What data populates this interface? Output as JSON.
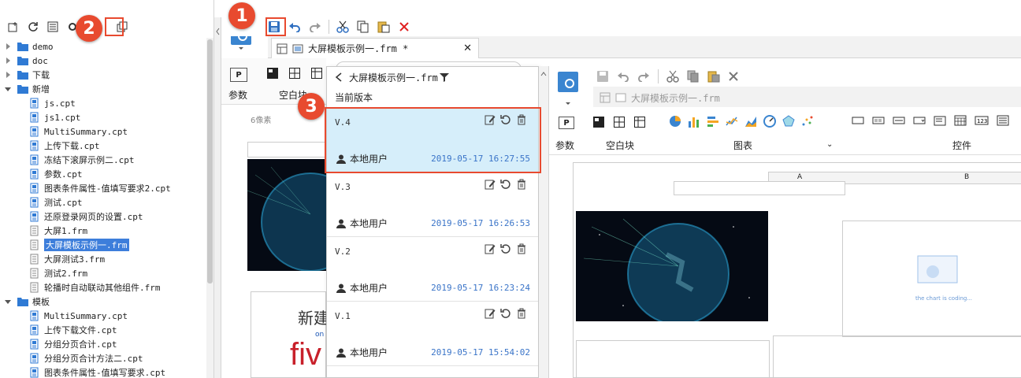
{
  "left_panel": {
    "tree": [
      {
        "label": "demo",
        "type": "folder",
        "level": 0,
        "expanded": false
      },
      {
        "label": "doc",
        "type": "folder",
        "level": 0,
        "expanded": false
      },
      {
        "label": "下载",
        "type": "folder",
        "level": 0,
        "expanded": false
      },
      {
        "label": "新增",
        "type": "folder",
        "level": 0,
        "expanded": true
      },
      {
        "label": "js.cpt",
        "type": "cpt",
        "level": 1
      },
      {
        "label": "js1.cpt",
        "type": "cpt",
        "level": 1
      },
      {
        "label": "MultiSummary.cpt",
        "type": "cpt",
        "level": 1
      },
      {
        "label": "上传下载.cpt",
        "type": "cpt",
        "level": 1
      },
      {
        "label": "冻结下滚屏示例二.cpt",
        "type": "cpt",
        "level": 1
      },
      {
        "label": "参数.cpt",
        "type": "cpt",
        "level": 1
      },
      {
        "label": "图表条件属性-值填写要求2.cpt",
        "type": "cpt",
        "level": 1
      },
      {
        "label": "测试.cpt",
        "type": "cpt",
        "level": 1
      },
      {
        "label": "还原登录网页的设置.cpt",
        "type": "cpt",
        "level": 1
      },
      {
        "label": "大屏1.frm",
        "type": "frm",
        "level": 1
      },
      {
        "label": "大屏模板示例一.frm",
        "type": "frm",
        "level": 1,
        "selected": true
      },
      {
        "label": "大屏测试3.frm",
        "type": "frm",
        "level": 1
      },
      {
        "label": "测试2.frm",
        "type": "frm",
        "level": 1
      },
      {
        "label": "轮播时自动联动其他组件.frm",
        "type": "frm",
        "level": 1
      },
      {
        "label": "模板",
        "type": "folder",
        "level": 0,
        "expanded": true
      },
      {
        "label": "MultiSummary.cpt",
        "type": "cpt",
        "level": 1
      },
      {
        "label": "上传下载文件.cpt",
        "type": "cpt",
        "level": 1
      },
      {
        "label": "分组分页合计.cpt",
        "type": "cpt",
        "level": 1
      },
      {
        "label": "分组分页合计方法二.cpt",
        "type": "cpt",
        "level": 1
      },
      {
        "label": "图表条件属性-值填写要求.cpt",
        "type": "cpt",
        "level": 1
      }
    ]
  },
  "editor": {
    "tab_label": "大屏模板示例一.frm *",
    "param_label": "参数",
    "blank_label": "空白块",
    "ruler_text": "6像素",
    "canvas_text_1": "新建",
    "canvas_text_2": "fiv",
    "canvas_text_3": "on"
  },
  "version_popup": {
    "title": "大屏模板示例一.frm",
    "current_label": "当前版本",
    "versions": [
      {
        "name": "V.4",
        "user": "本地用户",
        "time": "2019-05-17 16:27:55",
        "active": true
      },
      {
        "name": "V.3",
        "user": "本地用户",
        "time": "2019-05-17 16:26:53"
      },
      {
        "name": "V.2",
        "user": "本地用户",
        "time": "2019-05-17 16:23:24"
      },
      {
        "name": "V.1",
        "user": "本地用户",
        "time": "2019-05-17 15:54:02"
      }
    ]
  },
  "right_app": {
    "tab_label": "大屏模板示例一.frm",
    "param_label": "参数",
    "blank_label": "空白块",
    "chart_label": "图表",
    "control_label": "控件",
    "col_a": "A",
    "col_b": "B",
    "chart_placeholder": "the chart is coding..."
  },
  "badges": [
    "1",
    "2",
    "3"
  ],
  "colors": {
    "accent": "#e84a2f",
    "selected": "#3d7edb",
    "active_version": "#d6eefa",
    "time": "#3a74c8"
  }
}
